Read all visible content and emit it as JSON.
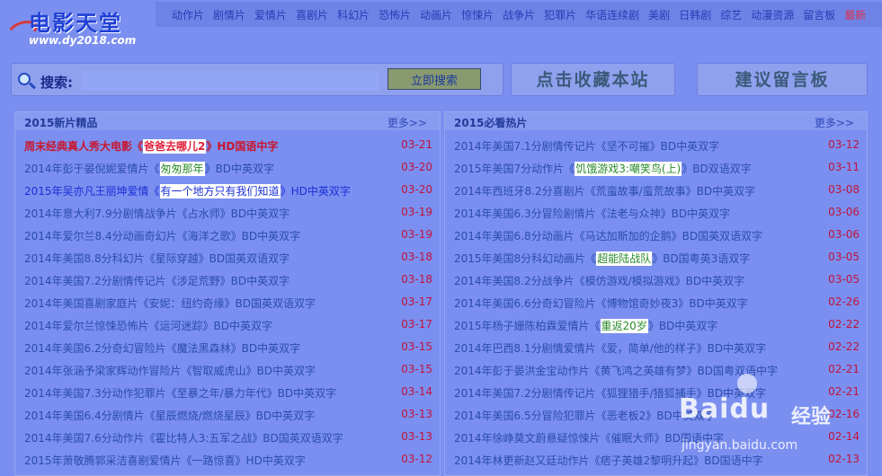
{
  "logo": {
    "title": "电影天堂",
    "url": "www.dy2018.com"
  },
  "nav": {
    "items": [
      "动作片",
      "剧情片",
      "爱情片",
      "喜剧片",
      "科幻片",
      "恐怖片",
      "动画片",
      "惊悚片",
      "战争片",
      "犯罪片",
      "华语连续剧",
      "美剧",
      "日韩剧",
      "综艺",
      "动漫资源",
      "留言板"
    ],
    "hot": "最新"
  },
  "search": {
    "label": "搜索:",
    "value": "",
    "button": "立即搜索"
  },
  "buttons": {
    "bookmark": "点击收藏本站",
    "feedback": "建议留言板"
  },
  "left_panel": {
    "title": "2015新片精品",
    "more": "更多>>",
    "items": [
      {
        "prefix": "周末经典真人秀大电影《",
        "hl": "爸爸去哪儿2",
        "suffix": "》HD国语中字",
        "date": "03-21"
      },
      {
        "prefix": "2014年彭于晏倪妮爱情片《",
        "hl": "匆匆那年",
        "suffix": "》BD中英双字",
        "date": "03-20"
      },
      {
        "prefix": "2015年吴亦凡王丽坤爱情《",
        "hl": "有一个地方只有我们知道",
        "suffix": "》HD中英双字",
        "date": "03-20"
      },
      {
        "text": "2014年意大利7.9分剧情战争片《占水师》BD中英双字",
        "date": "03-19"
      },
      {
        "text": "2014年爱尔兰8.4分动画奇幻片《海洋之歌》BD中英双字",
        "date": "03-19"
      },
      {
        "text": "2014年美国8.8分科幻片《星际穿越》BD国英双语双字",
        "date": "03-18"
      },
      {
        "text": "2014年美国7.2分剧情传记片《涉足荒野》BD中英双字",
        "date": "03-18"
      },
      {
        "text": "2014年美国喜剧家庭片《安妮：纽约奇缘》BD国英双语双字",
        "date": "03-17"
      },
      {
        "text": "2014年爱尔兰惊悚恐怖片《运河迷踪》BD中英双字",
        "date": "03-17"
      },
      {
        "text": "2014年美国6.2分奇幻冒险片《魔法黑森林》BD中英双字",
        "date": "03-15"
      },
      {
        "text": "2014年张涵予梁家辉动作冒险片《智取威虎山》BD中英双字",
        "date": "03-15"
      },
      {
        "text": "2014年美国7.3分动作犯罪片《至暴之年/暴力年代》BD中英双字",
        "date": "03-14"
      },
      {
        "text": "2014年美国6.4分剧情片《星辰燃烧/燃烧星辰》BD中英双字",
        "date": "03-13"
      },
      {
        "text": "2014年美国7.6分动作片《霍比特人3:五军之战》BD国英双语双字",
        "date": "03-13"
      },
      {
        "text": "2015年萧敬腾郭采洁喜剧爱情片《一路惊喜》HD中英双字",
        "date": "03-12"
      }
    ]
  },
  "right_panel": {
    "title": "2015必看热片",
    "more": "更多>>",
    "items": [
      {
        "text": "2014年美国7.1分剧情传记片《坚不可摧》BD中英双字",
        "date": "03-12"
      },
      {
        "prefix": "2015年美国7分动作片《",
        "hl": "饥饿游戏3:嘲笑鸟(上)",
        "suffix": "》BD双语双字",
        "date": "03-11"
      },
      {
        "text": "2014年西班牙8.2分喜剧片《荒蛮故事/蛮荒故事》BD中英双字",
        "date": "03-08"
      },
      {
        "text": "2014年美国6.3分冒险剧情片《法老与众神》BD中英双字",
        "date": "03-06"
      },
      {
        "text": "2014年美国6.8分动画片《马达加斯加的企鹅》BD国英双语双字",
        "date": "03-06"
      },
      {
        "prefix": "2015年美国8分科幻动画片《",
        "hl": "超能陆战队",
        "suffix": "》BD国粤英3语双字",
        "date": "03-05"
      },
      {
        "text": "2014年美国8.2分战争片《模仿游戏/模拟游戏》BD中英双字",
        "date": "03-05"
      },
      {
        "text": "2014年美国6.6分奇幻冒险片《博物馆奇妙夜3》BD中英双字",
        "date": "02-26"
      },
      {
        "prefix": "2015年杨子姗陈柏霖爱情片《",
        "hl": "重返20岁",
        "suffix": "》BD中英双字",
        "date": "02-22"
      },
      {
        "text": "2014年巴西8.1分剧情爱情片《爱，简单/他的样子》BD中英双字",
        "date": "02-22"
      },
      {
        "text": "2014年彭于晏洪金宝动作片《黄飞鸿之英雄有梦》BD国粤双语中字",
        "date": "02-21"
      },
      {
        "text": "2014年美国7.2分剧情传记片《狐狸猎手/猎狐捕手》BD中英双字",
        "date": "02-21"
      },
      {
        "text": "2014年美国6.5分冒险犯罪片《恶老板2》BD中英双字",
        "date": "02-16"
      },
      {
        "text": "2014年徐峥莫文蔚悬疑惊悚片《催眠大师》BD国语中字",
        "date": "02-14"
      },
      {
        "text": "2014年林更新赵又廷动作片《痞子英雄2黎明升起》BD国语中字",
        "date": "02-13"
      }
    ]
  },
  "watermark": {
    "logo": "Baidu",
    "text": "经验",
    "url": "jingyan.baidu.com"
  }
}
